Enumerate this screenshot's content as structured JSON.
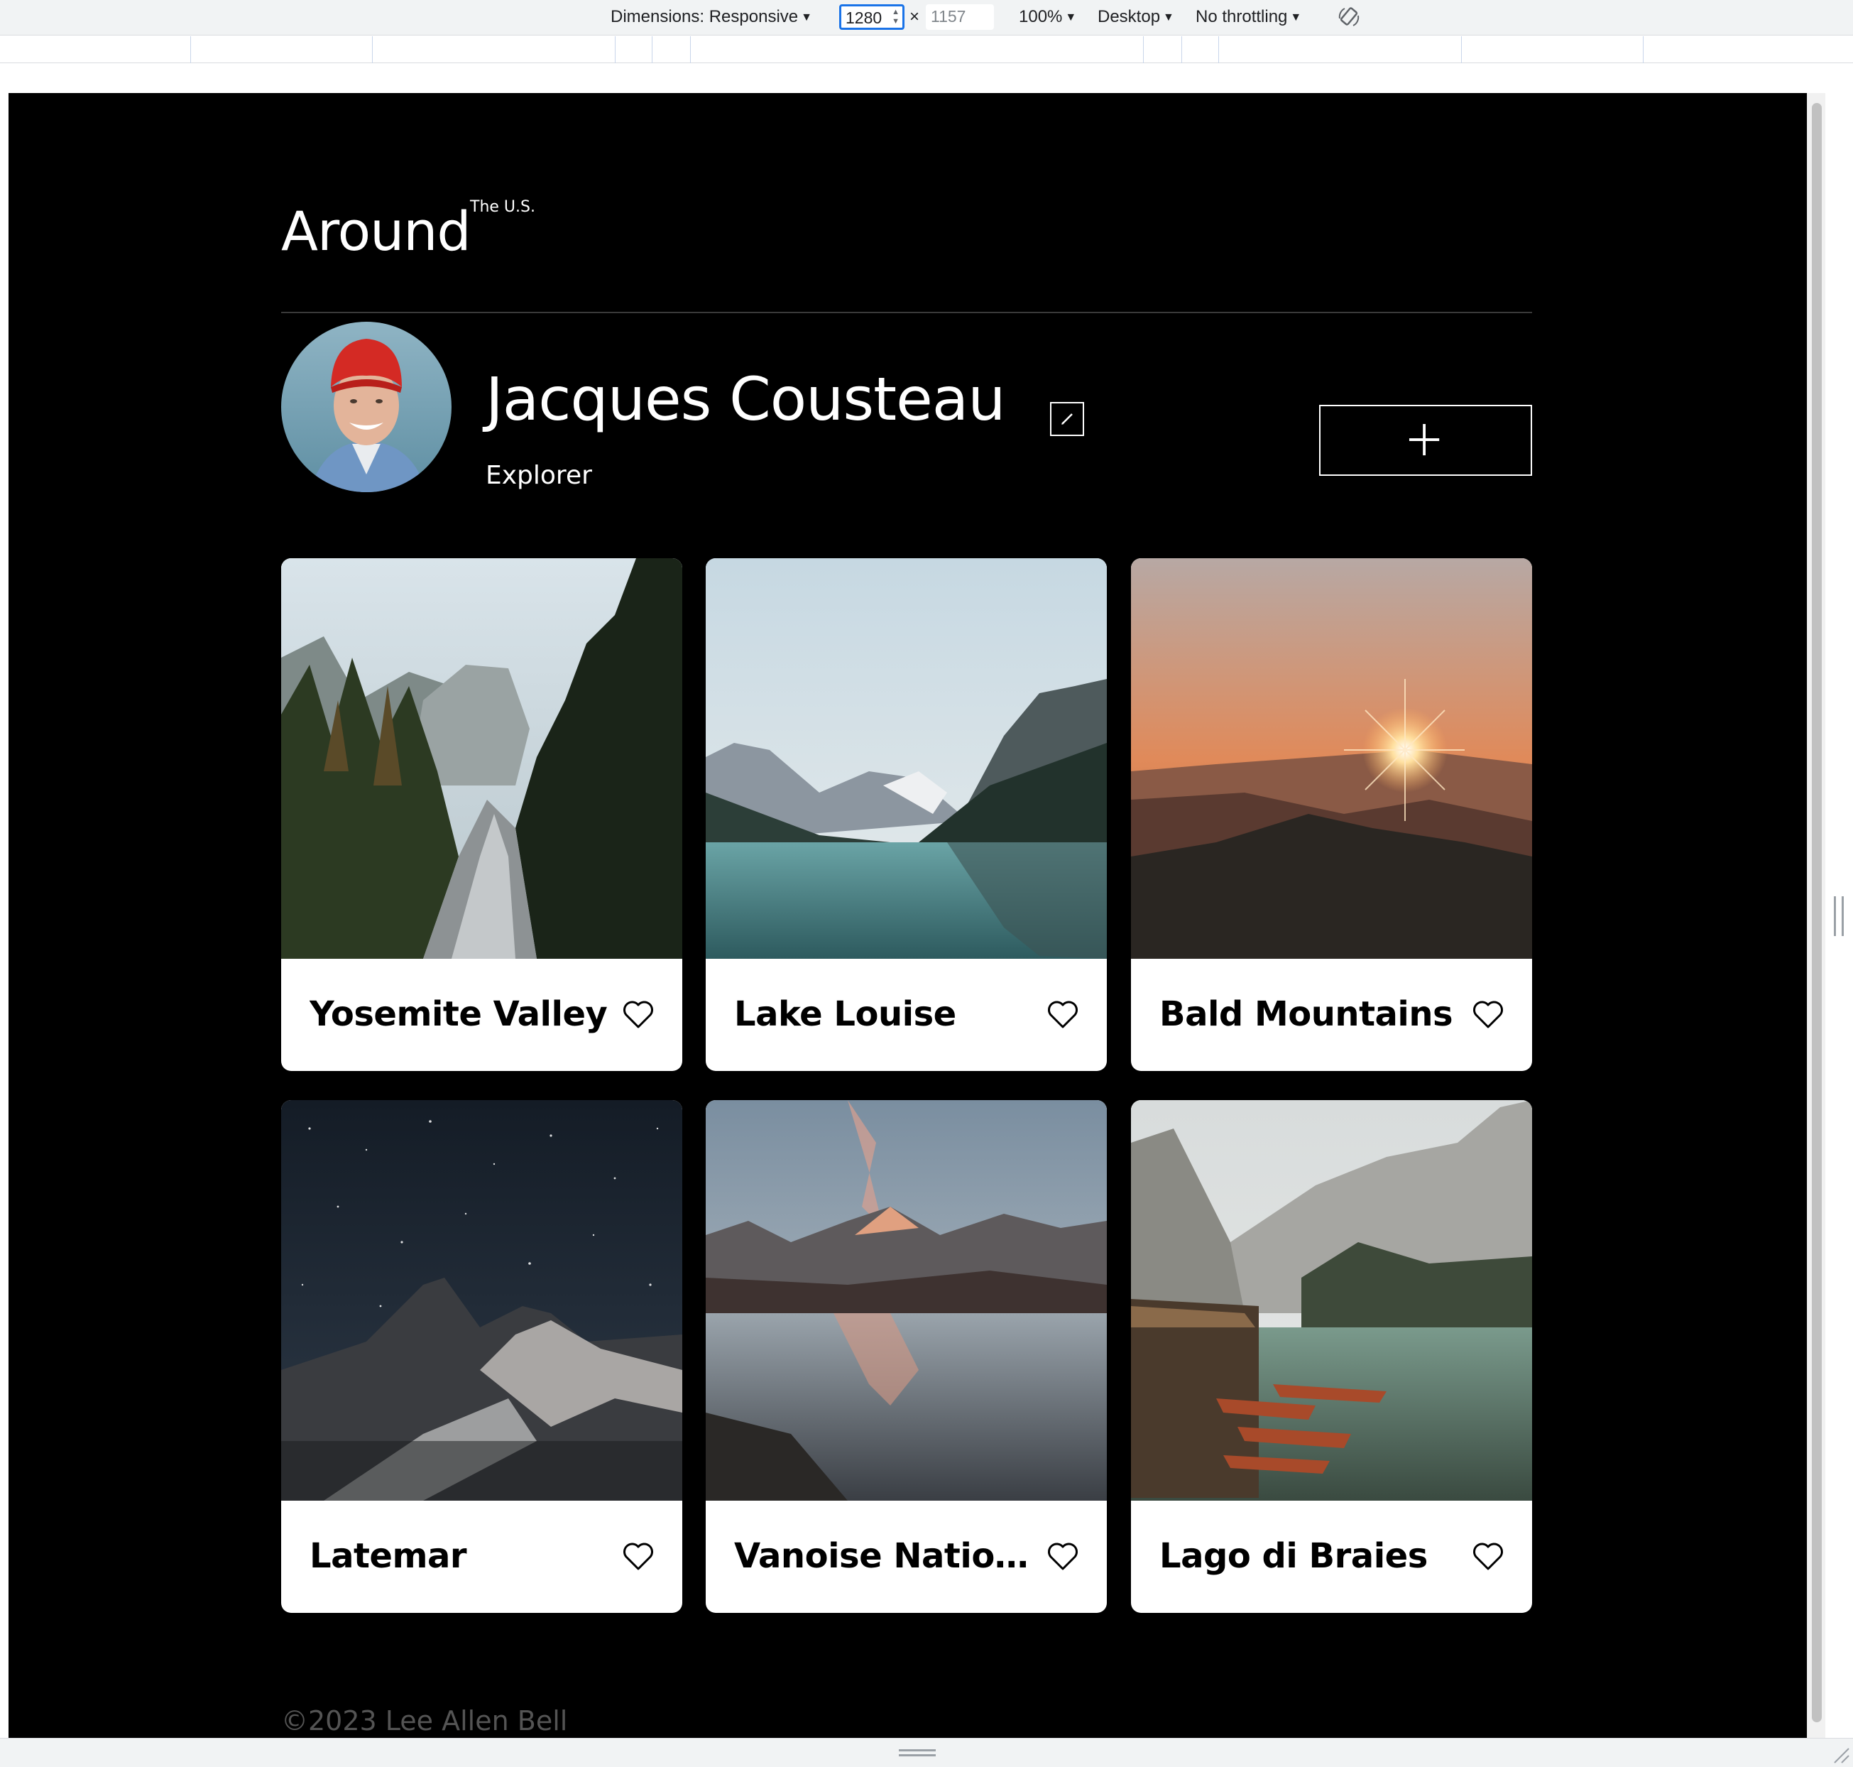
{
  "devtools": {
    "dimensions_label": "Dimensions: Responsive",
    "width_value": "1280",
    "times": "×",
    "height_placeholder": "1157",
    "zoom": "100%",
    "device": "Desktop",
    "throttling": "No throttling"
  },
  "header": {
    "logo": "Around",
    "logo_sup": "The U.S."
  },
  "profile": {
    "name": "Jacques Cousteau",
    "job": "Explorer"
  },
  "cards": [
    {
      "title": "Yosemite Valley"
    },
    {
      "title": "Lake Louise"
    },
    {
      "title": "Bald Mountains"
    },
    {
      "title": "Latemar"
    },
    {
      "title": "Vanoise National Park"
    },
    {
      "title": "Lago di Braies"
    }
  ],
  "footer": {
    "copyright": "©2023 Lee Allen Bell"
  },
  "colors": {
    "page_bg": "#000000",
    "card_bg": "#ffffff",
    "focus_blue": "#1a73e8",
    "footer_text": "#545454"
  },
  "icons": [
    "caret-down-icon",
    "rotate-icon",
    "edit-pencil-icon",
    "plus-icon",
    "heart-outline-icon"
  ]
}
